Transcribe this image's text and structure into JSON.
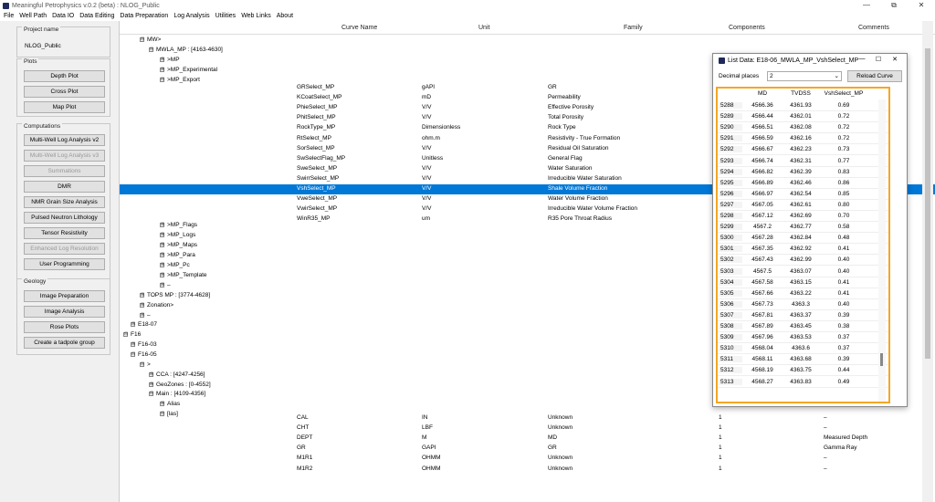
{
  "window": {
    "title": "Meaningful Petrophysics v.0.2 (beta) : NLOG_Public",
    "controls": [
      "—",
      "⧉",
      "✕"
    ]
  },
  "menu": [
    "File",
    "Well Path",
    "Data IO",
    "Data Editing",
    "Data Preparation",
    "Log Analysis",
    "Utilities",
    "Web Links",
    "About"
  ],
  "sidebar": {
    "project_title": "Project name",
    "project_name": "NLOG_Public",
    "plots_title": "Plots",
    "plots": [
      "Depth Plot",
      "Cross Plot",
      "Map Plot"
    ],
    "computations_title": "Computations",
    "computations": [
      {
        "label": "Multi-Well Log Analysis v2",
        "enabled": true
      },
      {
        "label": "Multi-Well Log Analysis v3",
        "enabled": false
      },
      {
        "label": "Summations",
        "enabled": false
      },
      {
        "label": "DMR",
        "enabled": true
      },
      {
        "label": "NMR Grain Size Analysis",
        "enabled": true
      },
      {
        "label": "Pulsed Neutron Lithology",
        "enabled": true
      },
      {
        "label": "Tensor Resistivity",
        "enabled": true
      },
      {
        "label": "Enhanced Log Resolution",
        "enabled": false
      },
      {
        "label": "User Programming",
        "enabled": true
      }
    ],
    "geology_title": "Geology",
    "geology": [
      "Image Preparation",
      "Image Analysis",
      "Rose Plots",
      "Create a tadpole group"
    ]
  },
  "columns": {
    "curve": "Curve Name",
    "unit": "Unit",
    "family": "Family",
    "components": "Components",
    "comments": "Comments"
  },
  "tree": [
    {
      "label": "MW>",
      "exp": "⊟"
    },
    {
      "label": "MWLA_MP : [4163-4630]",
      "exp": "⊟"
    },
    {
      "label": ">MP",
      "exp": "⊞"
    },
    {
      "label": ">MP_Experimental",
      "exp": "⊞"
    },
    {
      "label": ">MP_Export",
      "exp": "⊟"
    },
    {
      "label": ">MP_Flags",
      "exp": "⊞"
    },
    {
      "label": ">MP_Logs",
      "exp": "⊞"
    },
    {
      "label": ">MP_Maps",
      "exp": "⊞"
    },
    {
      "label": ">MP_Para",
      "exp": "⊞"
    },
    {
      "label": ">MP_Pc",
      "exp": "⊞"
    },
    {
      "label": ">MP_Template",
      "exp": "⊞"
    },
    {
      "label": "–",
      "exp": "⊞"
    },
    {
      "label": "TOPS MP : [3774-4628]",
      "exp": "⊞"
    },
    {
      "label": "Zonation>",
      "exp": "⊞"
    },
    {
      "label": "–",
      "exp": "⊞"
    },
    {
      "label": "E18-07",
      "exp": "⊞"
    },
    {
      "label": "F16",
      "exp": "⊟"
    },
    {
      "label": "F16-03",
      "exp": "⊞"
    },
    {
      "label": "F16-05",
      "exp": "⊟"
    },
    {
      "label": ">",
      "exp": "⊟"
    },
    {
      "label": "CCA : [4247-4256]",
      "exp": "⊞"
    },
    {
      "label": "GeoZones : [0-4552]",
      "exp": "⊞"
    },
    {
      "label": "Main : [4109-4356]",
      "exp": "⊟"
    },
    {
      "label": "Alias",
      "exp": "⊞"
    },
    {
      "label": "[las]",
      "exp": "⊟"
    }
  ],
  "export_curves": [
    {
      "name": "GRSelect_MP",
      "unit": "gAPI",
      "family": "GR",
      "components": "",
      "comments": ""
    },
    {
      "name": "KCoatSelect_MP",
      "unit": "mD",
      "family": "Permeability",
      "components": "",
      "comments": ""
    },
    {
      "name": "PhieSelect_MP",
      "unit": "V/V",
      "family": "Effective Porosity",
      "components": "",
      "comments": ""
    },
    {
      "name": "PhitSelect_MP",
      "unit": "V/V",
      "family": "Total Porosity",
      "components": "",
      "comments": ""
    },
    {
      "name": "RockType_MP",
      "unit": "Dimensionless",
      "family": "Rock Type",
      "components": "",
      "comments": ""
    },
    {
      "name": "RtSelect_MP",
      "unit": "ohm.m",
      "family": "Resistivity - True Formation",
      "components": "",
      "comments": ""
    },
    {
      "name": "SorSelect_MP",
      "unit": "V/V",
      "family": "Residual Oil Saturation",
      "components": "",
      "comments": ""
    },
    {
      "name": "SwSelectFlag_MP",
      "unit": "Unitless",
      "family": "General Flag",
      "components": "",
      "comments": ""
    },
    {
      "name": "SweSelect_MP",
      "unit": "V/V",
      "family": "Water Saturation",
      "components": "",
      "comments": ""
    },
    {
      "name": "SwirrSelect_MP",
      "unit": "V/V",
      "family": "Irreducible Water Saturation",
      "components": "",
      "comments": ""
    },
    {
      "name": "VshSelect_MP",
      "unit": "V/V",
      "family": "Shale Volume Fraction",
      "components": "",
      "comments": "",
      "selected": true
    },
    {
      "name": "VweSelect_MP",
      "unit": "V/V",
      "family": "Water Volume Fraction",
      "components": "",
      "comments": ""
    },
    {
      "name": "VwirSelect_MP",
      "unit": "V/V",
      "family": "Irreducible Water Volume Fraction",
      "components": "",
      "comments": ""
    },
    {
      "name": "WinR35_MP",
      "unit": "um",
      "family": "R35 Pore Throat Radius",
      "components": "",
      "comments": ""
    }
  ],
  "las_curves": [
    {
      "name": "CAL",
      "unit": "IN",
      "family": "Unknown",
      "components": "1",
      "comments": "–"
    },
    {
      "name": "CHT",
      "unit": "LBF",
      "family": "Unknown",
      "components": "1",
      "comments": "–"
    },
    {
      "name": "DEPT",
      "unit": "M",
      "family": "MD",
      "components": "1",
      "comments": "Measured Depth"
    },
    {
      "name": "GR",
      "unit": "GAPI",
      "family": "GR",
      "components": "1",
      "comments": "Gamma Ray"
    },
    {
      "name": "M1R1",
      "unit": "OHMM",
      "family": "Unknown",
      "components": "1",
      "comments": "–"
    },
    {
      "name": "M1R2",
      "unit": "OHMM",
      "family": "Unknown",
      "components": "1",
      "comments": "–"
    }
  ],
  "list_window": {
    "title": "List Data: E18-06_MWLA_MP_VshSelect_MP",
    "controls": [
      "—",
      "☐",
      "✕"
    ],
    "decimal_label": "Decimal places",
    "decimal_value": "2",
    "reload_label": "Reload Curve",
    "headers": {
      "md": "MD",
      "tvdss": "TVDSS",
      "vsh": "VshSelect_MP"
    },
    "rows": [
      [
        "5288",
        "4566.36",
        "4361.93",
        "0.69"
      ],
      [
        "5289",
        "4566.44",
        "4362.01",
        "0.72"
      ],
      [
        "5290",
        "4566.51",
        "4362.08",
        "0.72"
      ],
      [
        "5291",
        "4566.59",
        "4362.16",
        "0.72"
      ],
      [
        "5292",
        "4566.67",
        "4362.23",
        "0.73"
      ],
      [
        "5293",
        "4566.74",
        "4362.31",
        "0.77"
      ],
      [
        "5294",
        "4566.82",
        "4362.39",
        "0.83"
      ],
      [
        "5295",
        "4566.89",
        "4362.46",
        "0.86"
      ],
      [
        "5296",
        "4566.97",
        "4362.54",
        "0.85"
      ],
      [
        "5297",
        "4567.05",
        "4362.61",
        "0.80"
      ],
      [
        "5298",
        "4567.12",
        "4362.69",
        "0.70"
      ],
      [
        "5299",
        "4567.2",
        "4362.77",
        "0.58"
      ],
      [
        "5300",
        "4567.28",
        "4362.84",
        "0.48"
      ],
      [
        "5301",
        "4567.35",
        "4362.92",
        "0.41"
      ],
      [
        "5302",
        "4567.43",
        "4362.99",
        "0.40"
      ],
      [
        "5303",
        "4567.5",
        "4363.07",
        "0.40"
      ],
      [
        "5304",
        "4567.58",
        "4363.15",
        "0.41"
      ],
      [
        "5305",
        "4567.66",
        "4363.22",
        "0.41"
      ],
      [
        "5306",
        "4567.73",
        "4363.3",
        "0.40"
      ],
      [
        "5307",
        "4567.81",
        "4363.37",
        "0.39"
      ],
      [
        "5308",
        "4567.89",
        "4363.45",
        "0.38"
      ],
      [
        "5309",
        "4567.96",
        "4363.53",
        "0.37"
      ],
      [
        "5310",
        "4568.04",
        "4363.6",
        "0.37"
      ],
      [
        "5311",
        "4568.11",
        "4363.68",
        "0.39"
      ],
      [
        "5312",
        "4568.19",
        "4363.75",
        "0.44"
      ],
      [
        "5313",
        "4568.27",
        "4363.83",
        "0.49"
      ]
    ]
  },
  "colors": {
    "selection": "#0078d7",
    "highlight_frame": "#f5a623"
  }
}
